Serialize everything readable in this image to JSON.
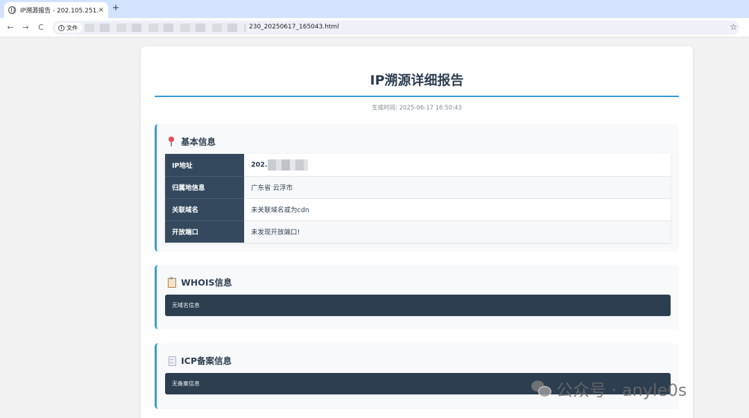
{
  "browser": {
    "tab_title": "IP溯源报告 - 202.105.251.230",
    "tab_close": "×",
    "new_tab": "+",
    "back": "←",
    "forward": "→",
    "reload": "C",
    "info_icon": "i",
    "info_label": "文件",
    "url_visible": "230_20250617_165043.html",
    "star": "☆"
  },
  "report": {
    "title": "IP溯源详细报告",
    "generated_time": "生成时间: 2025-06-17 16:50:43",
    "basic": {
      "icon": "pin-icon",
      "title": "基本信息",
      "rows": [
        {
          "key": "IP地址",
          "value": "202."
        },
        {
          "key": "归属地信息",
          "value": "广东省 云浮市"
        },
        {
          "key": "关联域名",
          "value": "未关联域名或为cdn"
        },
        {
          "key": "开放端口",
          "value": "未发现开放端口!"
        }
      ]
    },
    "whois": {
      "icon": "clipboard-icon",
      "title": "WHOIS信息",
      "content": "无域名信息"
    },
    "icp": {
      "icon": "doc-icon",
      "title": "ICP备案信息",
      "content": "无备案信息"
    }
  },
  "watermark": {
    "icon": "wechat-icon",
    "text": "公众号 · anyle0s"
  },
  "colors": {
    "accent": "#3498db",
    "header_dark": "#34495e",
    "code_bg": "#2c3e50",
    "title": "#2c3e50"
  }
}
